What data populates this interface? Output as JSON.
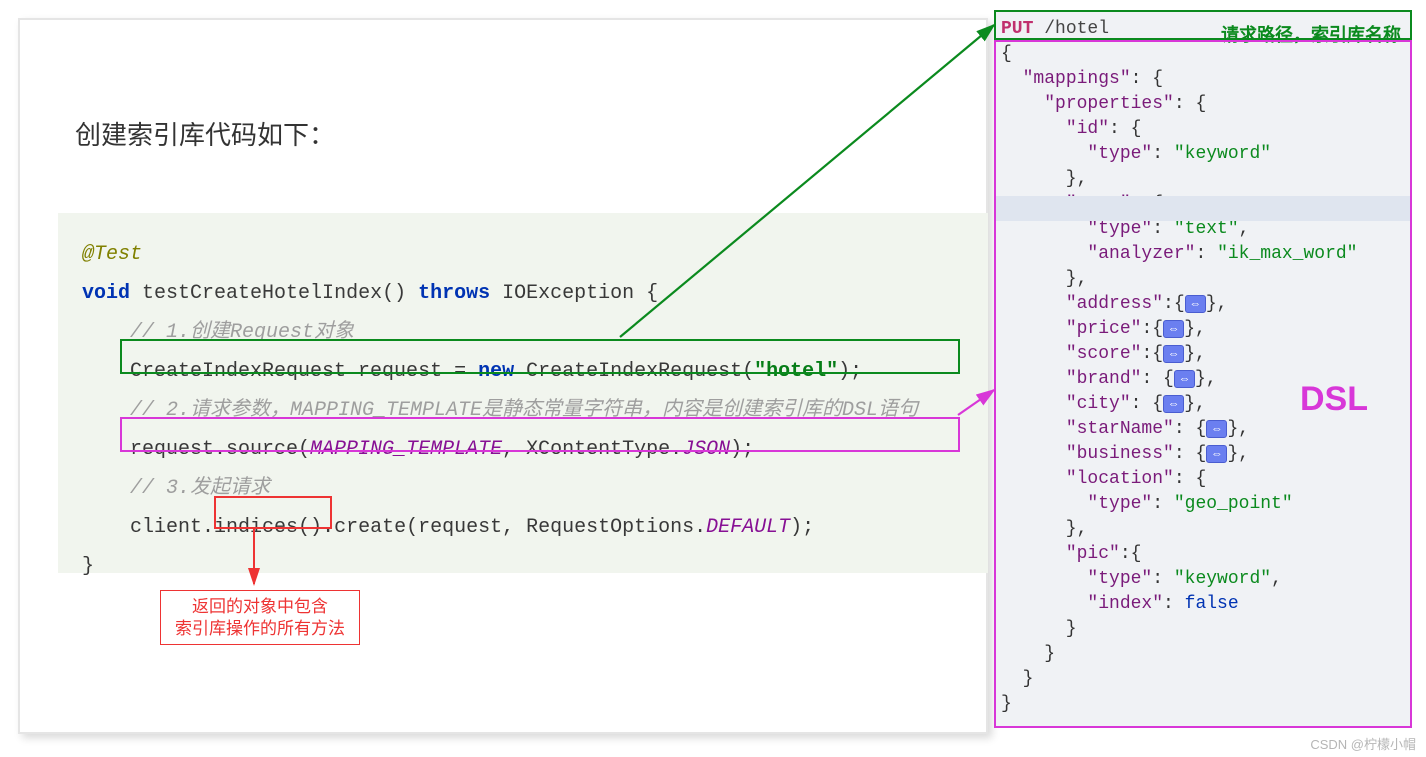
{
  "title": "创建索引库代码如下：",
  "code": {
    "annotation": "@Test",
    "sig_void": "void",
    "sig_name": "testCreateHotelIndex()",
    "sig_throws": "throws",
    "sig_exc": "IOException {",
    "c1": "// 1.创建Request对象",
    "l1_a": "CreateIndexRequest request = ",
    "l1_new": "new",
    "l1_b": " CreateIndexRequest(",
    "l1_str": "\"hotel\"",
    "l1_c": ");",
    "c2": "// 2.请求参数，MAPPING_TEMPLATE是静态常量字符串，内容是创建索引库的DSL语句",
    "l2_a": "request.source(",
    "l2_mt": "MAPPING_TEMPLATE",
    "l2_b": ", XContentType.",
    "l2_json": "JSON",
    "l2_c": ");",
    "c3": "// 3.发起请求",
    "l3_a": "client.",
    "l3_ind": "indices()",
    "l3_b": ".create(request, RequestOptions.",
    "l3_def": "DEFAULT",
    "l3_c": ");",
    "close": "}"
  },
  "note_line1": "返回的对象中包含",
  "note_line2": "索引库操作的所有方法",
  "right_header": {
    "put": "PUT",
    "path": "/hotel",
    "label": "请求路径，索引库名称"
  },
  "dsl_label": "DSL",
  "json": {
    "mappings": "\"mappings\"",
    "properties": "\"properties\"",
    "id": "\"id\"",
    "type": "\"type\"",
    "keyword": "\"keyword\"",
    "name": "\"name\"",
    "text": "\"text\"",
    "analyzer": "\"analyzer\"",
    "ik": "\"ik_max_word\"",
    "address": "\"address\"",
    "price": "\"price\"",
    "score": "\"score\"",
    "brand": "\"brand\"",
    "city": "\"city\"",
    "starName": "\"starName\"",
    "business": "\"business\"",
    "location": "\"location\"",
    "geo_point": "\"geo_point\"",
    "pic": "\"pic\"",
    "index": "\"index\"",
    "false": "false"
  },
  "watermark": "CSDN @柠檬小帽"
}
